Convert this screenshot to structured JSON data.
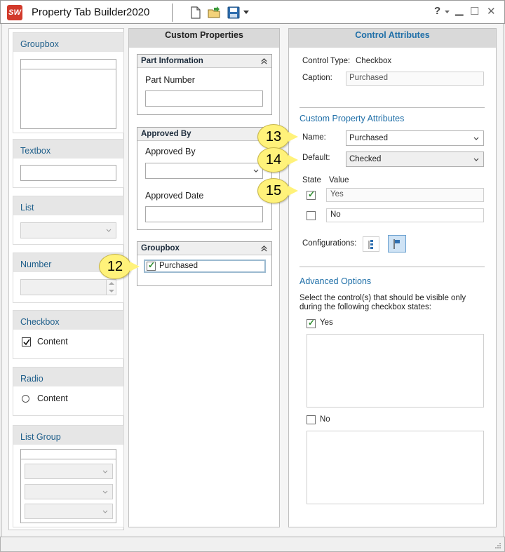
{
  "window": {
    "title": "Property Tab Builder",
    "year": "2020",
    "logo_text": "SW",
    "help_label": "?",
    "minimize_label": "▁",
    "maximize_label": "☐",
    "close_label": "✕"
  },
  "palette": {
    "groupbox": "Groupbox",
    "textbox": "Textbox",
    "list": "List",
    "number": "Number",
    "checkbox": "Checkbox",
    "checkbox_content": "Content",
    "radio": "Radio",
    "radio_content": "Content",
    "list_group": "List Group"
  },
  "custom_properties": {
    "header": "Custom Properties",
    "part_information": {
      "title": "Part Information",
      "part_number_label": "Part Number",
      "part_number_value": ""
    },
    "approved_by_group": {
      "title": "Approved By",
      "approved_by_label": "Approved By",
      "approved_by_value": "",
      "approved_date_label": "Approved Date",
      "approved_date_value": ""
    },
    "groupbox": {
      "title": "Groupbox",
      "checkbox_label": "Purchased"
    }
  },
  "control_attributes": {
    "header": "Control Attributes",
    "control_type_label": "Control Type:",
    "control_type_value": "Checkbox",
    "caption_label": "Caption:",
    "caption_value": "Purchased",
    "custom_property_attributes": "Custom Property Attributes",
    "name_label": "Name:",
    "name_value": "Purchased",
    "default_label": "Default:",
    "default_value": "Checked",
    "state_header": "State",
    "value_header": "Value",
    "state_rows": [
      {
        "checked": true,
        "value": "Yes"
      },
      {
        "checked": false,
        "value": "No"
      }
    ],
    "configurations_label": "Configurations:",
    "advanced_options": "Advanced Options",
    "advanced_description": "Select the control(s) that should be visible only during the following checkbox states:",
    "yes_label": "Yes",
    "no_label": "No"
  },
  "callouts": [
    "12",
    "13",
    "14",
    "15"
  ],
  "colors": {
    "accent_blue": "#1f6fa8",
    "callout_yellow": "#fff27a",
    "header_gray": "#d9d9d9"
  }
}
